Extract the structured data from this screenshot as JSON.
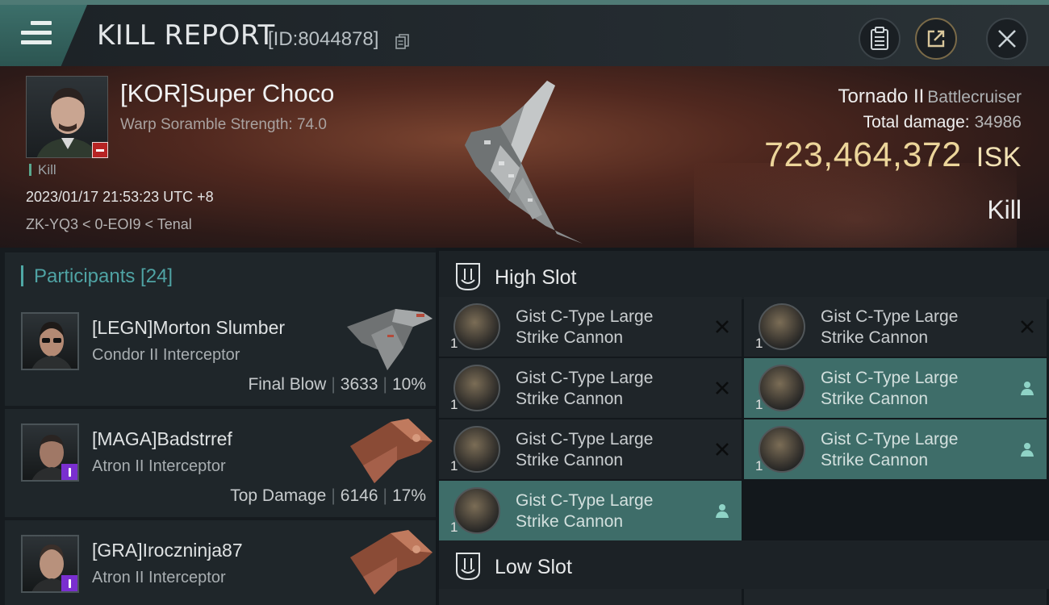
{
  "header": {
    "title": "KILL REPORT",
    "report_id": "[ID:8044878]",
    "icons": [
      "menu-icon",
      "copy-icon",
      "clipboard-icon",
      "share-icon",
      "close-icon"
    ]
  },
  "victim": {
    "name": "[KOR]Super Choco",
    "scramble": "Warp Soramble Strength: 74.0",
    "kill_tag": "Kill",
    "timestamp": "2023/01/17 21:53:23 UTC +8",
    "location": "ZK-YQ3 < 0-EOI9 < Tenal",
    "ship_name": "Tornado II",
    "ship_class": "Battlecruiser",
    "total_damage_label": "Total damage:",
    "total_damage": "34986",
    "isk_value": "723,464,372",
    "isk_unit": "ISK",
    "result": "Kill"
  },
  "participants": {
    "label": "Participants [24]",
    "rows": [
      {
        "name": "[LEGN]Morton Slumber",
        "ship": "Condor II Interceptor",
        "role": "Final Blow",
        "damage": "3633",
        "percent": "10%",
        "badge": ""
      },
      {
        "name": "[MAGA]Badstrref",
        "ship": "Atron II Interceptor",
        "role": "Top Damage",
        "damage": "6146",
        "percent": "17%",
        "badge": "purple"
      },
      {
        "name": "[GRA]Iroczninja87",
        "ship": "Atron II Interceptor",
        "role": "",
        "damage": "",
        "percent": "",
        "badge": "purple"
      }
    ]
  },
  "slots": {
    "high_label": "High Slot",
    "low_label": "Low Slot",
    "high_modules": [
      {
        "name_line1": "Gist C-Type Large",
        "name_line2": "Strike Cannon",
        "qty": "1",
        "state": "destroyed"
      },
      {
        "name_line1": "Gist C-Type Large",
        "name_line2": "Strike Cannon",
        "qty": "1",
        "state": "destroyed"
      },
      {
        "name_line1": "Gist C-Type Large",
        "name_line2": "Strike Cannon",
        "qty": "1",
        "state": "destroyed"
      },
      {
        "name_line1": "Gist C-Type Large",
        "name_line2": "Strike Cannon",
        "qty": "1",
        "state": "dropped"
      },
      {
        "name_line1": "Gist C-Type Large",
        "name_line2": "Strike Cannon",
        "qty": "1",
        "state": "destroyed"
      },
      {
        "name_line1": "Gist C-Type Large",
        "name_line2": "Strike Cannon",
        "qty": "1",
        "state": "dropped"
      },
      {
        "name_line1": "Gist C-Type Large",
        "name_line2": "Strike Cannon",
        "qty": "1",
        "state": "dropped"
      }
    ]
  }
}
